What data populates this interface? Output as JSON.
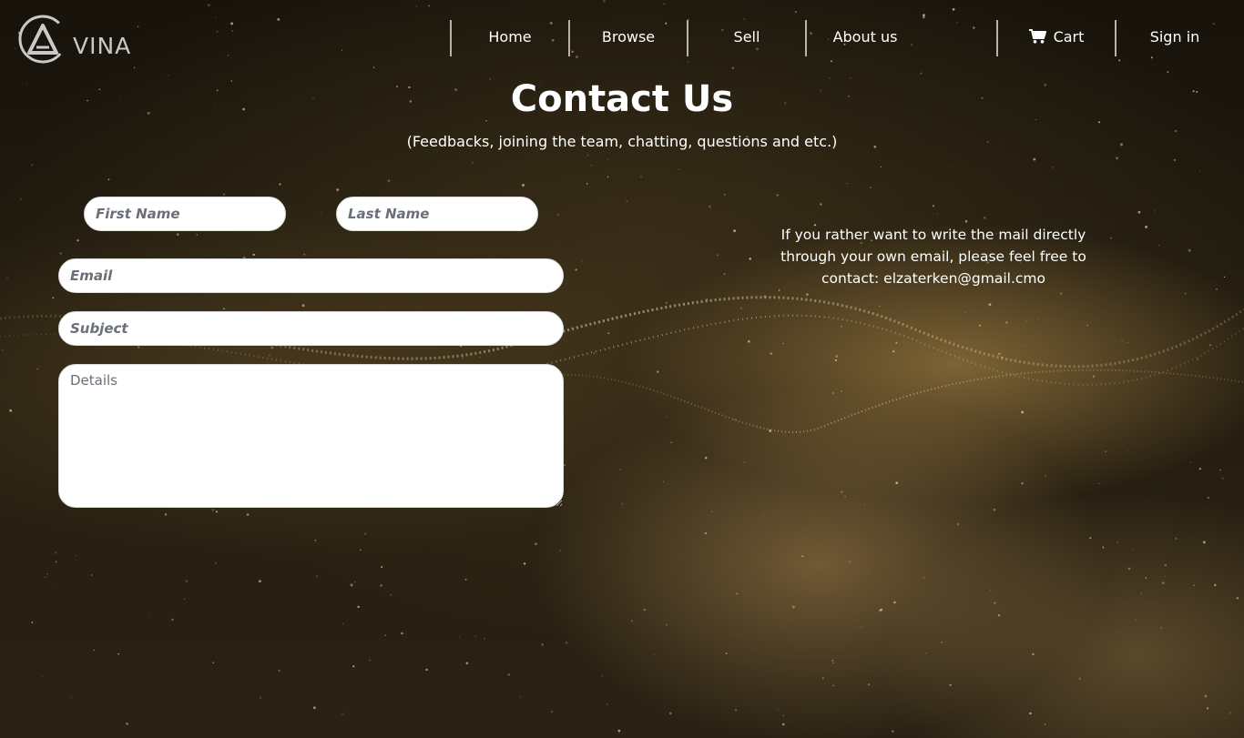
{
  "brand": {
    "logo_text": "VINA"
  },
  "nav": {
    "items": [
      {
        "label": "Home"
      },
      {
        "label": "Browse"
      },
      {
        "label": "Sell"
      },
      {
        "label": "About us"
      }
    ],
    "cart_label": "Cart",
    "signin_label": "Sign in"
  },
  "header": {
    "title": "Contact Us",
    "subtitle": "(Feedbacks, joining the team, chatting, questions and etc.)"
  },
  "form": {
    "first_name_placeholder": "First Name",
    "last_name_placeholder": "Last Name",
    "email_placeholder": "Email",
    "subject_placeholder": "Subject",
    "details_placeholder": "Details"
  },
  "contact": {
    "note_line1": "If you rather want to write the mail directly",
    "note_line2": "through your own email, please feel free to",
    "note_line3": "contact: elzaterken@gmail.cmo"
  },
  "colors": {
    "background": "#241d10",
    "accent_gold": "#c9a560",
    "text": "#ffffff",
    "divider": "#b9b4aa"
  }
}
